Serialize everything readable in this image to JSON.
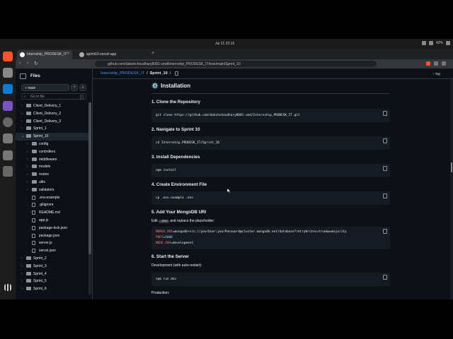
{
  "os": {
    "clock": "Jul 21  22:15",
    "battery": "42%"
  },
  "dock": {
    "icons": [
      "brave-icon",
      "terminal-icon",
      "vscode-icon",
      "music-icon",
      "settings-icon",
      "disk-icon",
      "usb-icon",
      "disk2-icon",
      "trash-icon",
      "apps-grid-icon"
    ]
  },
  "browser": {
    "tabs": [
      {
        "label": "Internship_PRODESK_IT"
      },
      {
        "label": "sprint10.vercel.app"
      }
    ],
    "new_tab": "+",
    "url": "github.com/dakshchoudhary8081-cmd/Internship_PRODESK_IT/tree/main/Sprint_10"
  },
  "sidebar": {
    "title": "Files",
    "branch": "main",
    "add_label": "+",
    "search_label": "⌕",
    "go_to_file": "Go to file",
    "go_to_file_key": "t",
    "tree": [
      {
        "label": "Client_Delivery_1",
        "type": "folder",
        "depth": 0,
        "selected": false
      },
      {
        "label": "Client_Delivery_2",
        "type": "folder",
        "depth": 0,
        "selected": false
      },
      {
        "label": "Client_Delivery_3",
        "type": "folder",
        "depth": 0,
        "selected": false
      },
      {
        "label": "Sprint_1",
        "type": "folder",
        "depth": 0,
        "selected": false
      },
      {
        "label": "Sprint_10",
        "type": "folder-open",
        "depth": 0,
        "selected": true
      },
      {
        "label": "config",
        "type": "folder",
        "depth": 1,
        "selected": false
      },
      {
        "label": "controllers",
        "type": "folder",
        "depth": 1,
        "selected": false
      },
      {
        "label": "middleware",
        "type": "folder",
        "depth": 1,
        "selected": false
      },
      {
        "label": "models",
        "type": "folder",
        "depth": 1,
        "selected": false
      },
      {
        "label": "routes",
        "type": "folder",
        "depth": 1,
        "selected": false
      },
      {
        "label": "utils",
        "type": "folder",
        "depth": 1,
        "selected": false
      },
      {
        "label": "validators",
        "type": "folder",
        "depth": 1,
        "selected": false
      },
      {
        "label": ".env.example",
        "type": "file",
        "depth": 1,
        "selected": false
      },
      {
        "label": ".gitignore",
        "type": "file",
        "depth": 1,
        "selected": false
      },
      {
        "label": "README.md",
        "type": "file",
        "depth": 1,
        "selected": false
      },
      {
        "label": "app.js",
        "type": "file",
        "depth": 1,
        "selected": false
      },
      {
        "label": "package-lock.json",
        "type": "file",
        "depth": 1,
        "selected": false
      },
      {
        "label": "package.json",
        "type": "file",
        "depth": 1,
        "selected": false
      },
      {
        "label": "server.js",
        "type": "file",
        "depth": 1,
        "selected": false
      },
      {
        "label": "vercel.json",
        "type": "file",
        "depth": 1,
        "selected": false
      },
      {
        "label": "Sprint_2",
        "type": "folder",
        "depth": 0,
        "selected": false
      },
      {
        "label": "Sprint_3",
        "type": "folder",
        "depth": 0,
        "selected": false
      },
      {
        "label": "Sprint_4",
        "type": "folder",
        "depth": 0,
        "selected": false
      },
      {
        "label": "Sprint_5",
        "type": "folder",
        "depth": 0,
        "selected": false
      },
      {
        "label": "Sprint_6",
        "type": "folder",
        "depth": 0,
        "selected": false
      }
    ]
  },
  "main": {
    "breadcrumb_repo": "Internship_PRODESK_IT",
    "breadcrumb_sep": "/",
    "breadcrumb_dir": "Sprint_10",
    "top_label": "Top",
    "section_icon": "⚙️",
    "section_title": "Installation",
    "steps": [
      {
        "title": "1. Clone the Repository",
        "code": [
          "git clone https://github.com/dakshchoudhary8081-cmd/Internship_PRODESK_IT.git"
        ]
      },
      {
        "title": "2. Navigate to Sprint 10",
        "code": [
          "cd Internship_PRODESK_IT/Sprint_10"
        ]
      },
      {
        "title": "3. Install Dependencies",
        "code": [
          "npm install"
        ]
      },
      {
        "title": "4. Create Environment File",
        "code": [
          "cp .env.example .env"
        ]
      },
      {
        "title": "5. Add Your MongoDB URI"
      },
      {
        "title": "6. Start the Server"
      }
    ],
    "edit_prefix": "Edit",
    "edit_code": ".env",
    "edit_suffix": "and replace the placeholder:",
    "env_lines": [
      {
        "key": "MONGO_URI",
        "value": "mongodb+srv://yourUser:yourPassword@cluster.mongodb.net/database?retryWrites=true&w=majority"
      },
      {
        "key": "PORT",
        "value": "5000"
      },
      {
        "key": "NODE_ENV",
        "value": "development"
      }
    ],
    "dev_label": "Development (with auto-restart):",
    "dev_code": "npm run dev",
    "prod_label": "Production:"
  }
}
